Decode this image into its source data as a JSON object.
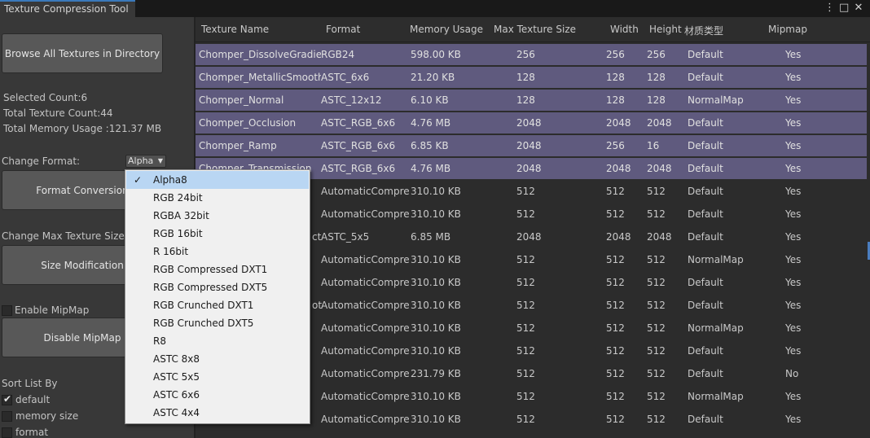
{
  "window": {
    "tab_title": "Texture Compression Tool",
    "menu_icon": "⋮",
    "maximize_icon": "□",
    "close_icon": "✕"
  },
  "left": {
    "browse_button": "Browse All Textures in Directory",
    "selected_count": "Selected Count:6",
    "total_count": "Total Texture Count:44",
    "total_memory": "Total Memory Usage :121.37 MB",
    "change_format_label": "Change Format:",
    "format_value": "Alpha",
    "format_button": "Format Conversion",
    "change_max_size_label": "Change Max Texture Size:",
    "size_button": "Size Modification",
    "enable_mipmap_label": "Enable MipMap",
    "mipmap_button": "Disable MipMap",
    "sort_label": "Sort List By",
    "sort_options": [
      "default",
      "memory size",
      "format"
    ]
  },
  "table": {
    "headers": [
      "Texture Name",
      "Format",
      "Memory Usage",
      "Max Texture Size",
      "Width",
      "Height",
      "材质类型",
      "Mipmap"
    ],
    "rows": [
      [
        "Chomper_DissolveGradient",
        "RGB24",
        "598.00 KB",
        "256",
        "256",
        "256",
        "Default",
        "Yes"
      ],
      [
        "Chomper_MetallicSmoothness",
        "ASTC_6x6",
        "21.20 KB",
        "128",
        "128",
        "128",
        "Default",
        "Yes"
      ],
      [
        "Chomper_Normal",
        "ASTC_12x12",
        "6.10 KB",
        "128",
        "128",
        "128",
        "NormalMap",
        "Yes"
      ],
      [
        "Chomper_Occlusion",
        "ASTC_RGB_6x6",
        "4.76 MB",
        "2048",
        "2048",
        "2048",
        "Default",
        "Yes"
      ],
      [
        "Chomper_Ramp",
        "ASTC_RGB_6x6",
        "6.85 KB",
        "2048",
        "256",
        "16",
        "Default",
        "Yes"
      ],
      [
        "Chomper_Transmission",
        "ASTC_RGB_6x6",
        "4.76 MB",
        "2048",
        "2048",
        "2048",
        "Default",
        "Yes"
      ],
      [
        "",
        "AutomaticCompressed",
        "310.10 KB",
        "512",
        "512",
        "512",
        "Default",
        "Yes"
      ],
      [
        "",
        "AutomaticCompressed",
        "310.10 KB",
        "512",
        "512",
        "512",
        "Default",
        "Yes"
      ],
      [
        "ct",
        "ASTC_5x5",
        "6.85 MB",
        "2048",
        "2048",
        "2048",
        "Default",
        "Yes"
      ],
      [
        "",
        "AutomaticCompressed",
        "310.10 KB",
        "512",
        "512",
        "512",
        "NormalMap",
        "Yes"
      ],
      [
        "",
        "AutomaticCompressed",
        "310.10 KB",
        "512",
        "512",
        "512",
        "Default",
        "Yes"
      ],
      [
        "ot",
        "AutomaticCompressed",
        "310.10 KB",
        "512",
        "512",
        "512",
        "Default",
        "Yes"
      ],
      [
        "",
        "AutomaticCompressed",
        "310.10 KB",
        "512",
        "512",
        "512",
        "NormalMap",
        "Yes"
      ],
      [
        "",
        "AutomaticCompressed",
        "310.10 KB",
        "512",
        "512",
        "512",
        "Default",
        "Yes"
      ],
      [
        "",
        "AutomaticCompressed",
        "231.79 KB",
        "512",
        "512",
        "512",
        "Default",
        "No"
      ],
      [
        "",
        "AutomaticCompressed",
        "310.10 KB",
        "512",
        "512",
        "512",
        "NormalMap",
        "Yes"
      ],
      [
        "",
        "AutomaticCompressed",
        "310.10 KB",
        "512",
        "512",
        "512",
        "Default",
        "Yes"
      ]
    ],
    "selected_rows": 6
  },
  "format_menu": {
    "items": [
      "Alpha8",
      "RGB 24bit",
      "RGBA 32bit",
      "RGB 16bit",
      "R 16bit",
      "RGB Compressed DXT1",
      "RGB Compressed DXT5",
      "RGB Crunched DXT1",
      "RGB Crunched DXT5",
      "R8",
      "ASTC 8x8",
      "ASTC 5x5",
      "ASTC 6x6",
      "ASTC 4x4"
    ],
    "selected_index": 0,
    "check_icon": "✓"
  }
}
